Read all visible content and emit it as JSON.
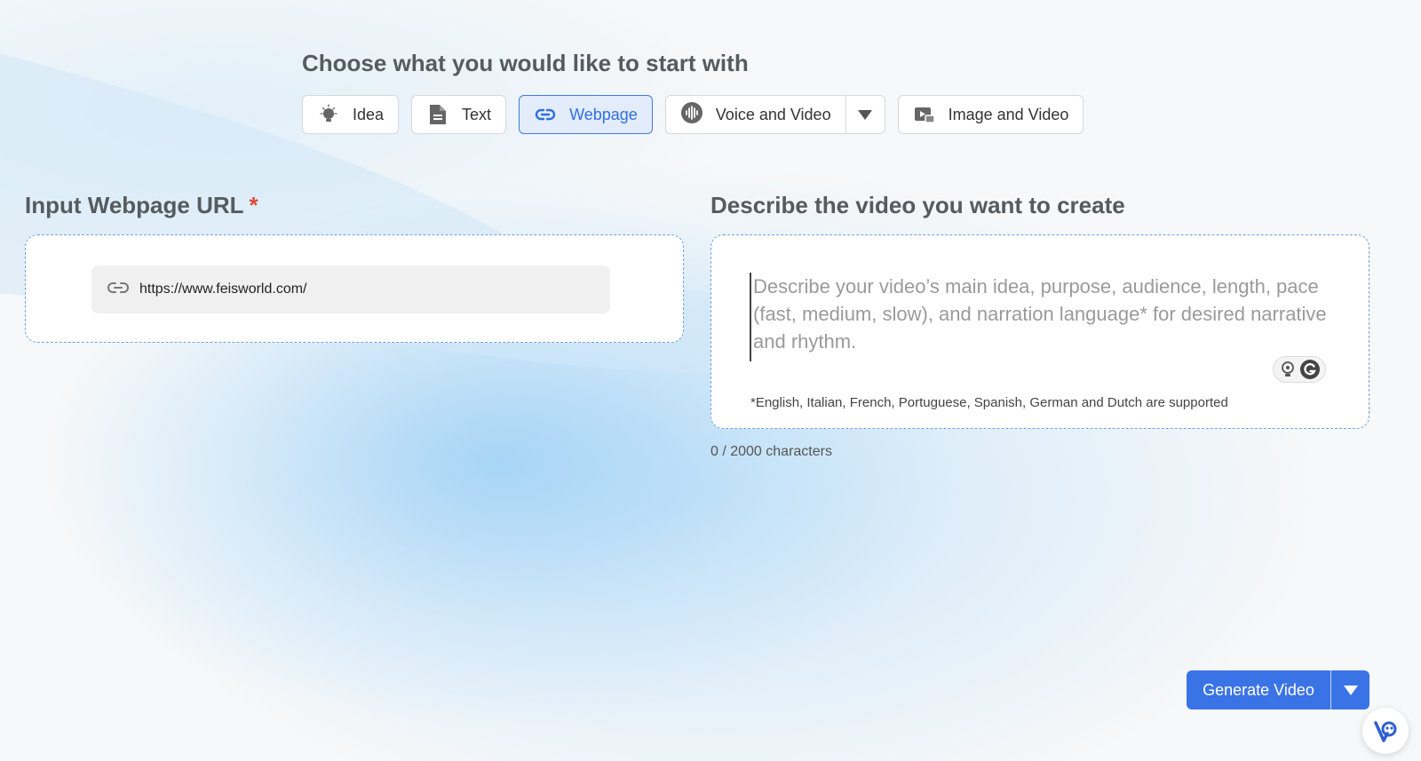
{
  "header": {
    "title": "Choose what you would like to start with"
  },
  "modes": [
    {
      "label": "Idea",
      "icon": "lightbulb-icon",
      "active": false
    },
    {
      "label": "Text",
      "icon": "document-icon",
      "active": false
    },
    {
      "label": "Webpage",
      "icon": "link-icon",
      "active": true
    },
    {
      "label": "Voice and Video",
      "icon": "audio-wave-icon",
      "active": false
    },
    {
      "label": "Image and Video",
      "icon": "image-video-icon",
      "active": false
    }
  ],
  "url_section": {
    "title": "Input Webpage URL",
    "required_mark": "*",
    "value": "https://www.feisworld.com/"
  },
  "describe_section": {
    "title": "Describe the video you want to create",
    "placeholder": "Describe your video’s main idea, purpose, audience, length, pace (fast, medium, slow), and narration language* for desired narrative and rhythm.",
    "language_note": "*English, Italian, French, Portuguese, Spanish, German and Dutch are supported",
    "char_count": "0 / 2000 characters"
  },
  "actions": {
    "generate_label": "Generate Video"
  },
  "colors": {
    "accent": "#3a73e6",
    "active_bg": "#e3ecfb",
    "required": "#e0483b",
    "dashed_border": "#6f9fe0"
  }
}
